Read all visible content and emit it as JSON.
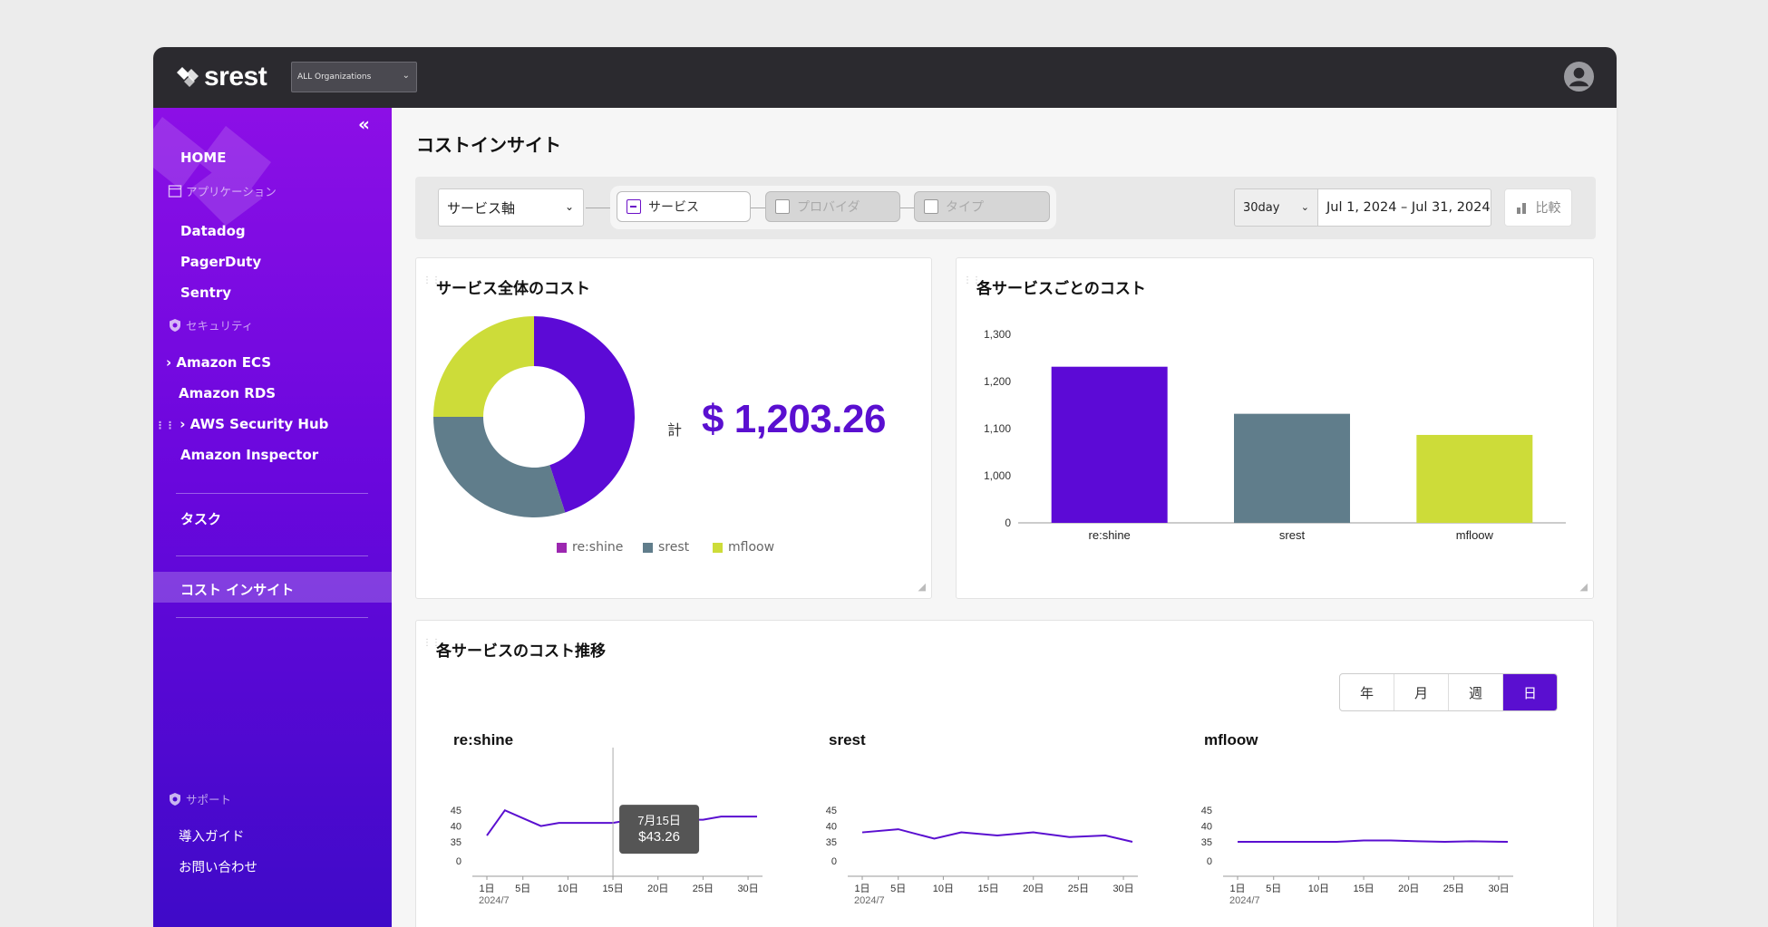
{
  "header": {
    "logo": "srest",
    "org_select": "ALL Organizations"
  },
  "sidebar": {
    "home": "HOME",
    "section_apps": "アプリケーション",
    "apps": [
      "Datadog",
      "PagerDuty",
      "Sentry"
    ],
    "section_security": "セキュリティ",
    "security": [
      "Amazon ECS",
      "Amazon RDS",
      "AWS Security Hub",
      "Amazon Inspector"
    ],
    "task": "タスク",
    "cost_insight": "コスト インサイト",
    "section_support": "サポート",
    "support": [
      "導入ガイド",
      "お問い合わせ"
    ]
  },
  "page": {
    "title": "コストインサイト"
  },
  "filters": {
    "axis": "サービス軸",
    "chips": [
      "サービス",
      "プロバイダ",
      "タイプ"
    ],
    "period": "30day",
    "date_range": "Jul 1, 2024  – Jul 31, 2024",
    "compare": "比較"
  },
  "overall": {
    "title": "サービス全体のコスト",
    "total_label": "計",
    "total_value": "$ 1,203.26"
  },
  "per_service": {
    "title": "各サービスごとのコスト"
  },
  "trend": {
    "title": "各サービスのコスト推移",
    "granularity": [
      "年",
      "月",
      "週",
      "日"
    ],
    "active": "日",
    "tooltip": {
      "date": "7月15日",
      "value": "$43.26"
    }
  },
  "colors": {
    "reshine": "#5c0ad6",
    "srest": "#607d8b",
    "mfloow": "#cddc39",
    "line": "#5a0fd0"
  },
  "chart_data": [
    {
      "type": "pie",
      "title": "",
      "categories": [
        "re:shine",
        "srest",
        "mfloow"
      ],
      "values": [
        45,
        30,
        25
      ]
    },
    {
      "type": "bar",
      "title": "",
      "categories": [
        "re:shine",
        "srest",
        "mfloow"
      ],
      "values": [
        1210,
        1112,
        1068
      ],
      "yticks": [
        "0",
        "1,000",
        "1,100",
        "1,200",
        "1,300"
      ],
      "ylim": [
        900,
        1300
      ]
    },
    {
      "type": "line",
      "title": "re:shine",
      "x": [
        1,
        3,
        5,
        7,
        9,
        11,
        13,
        15,
        17,
        19,
        21,
        23,
        25,
        27,
        29,
        31
      ],
      "values": [
        37,
        45,
        42.5,
        40,
        41,
        41,
        41,
        41,
        42,
        42,
        42,
        42,
        42,
        43,
        43,
        43
      ],
      "xticks": [
        "1日",
        "5日",
        "10日",
        "15日",
        "20日",
        "25日",
        "30日"
      ],
      "xsub": "2024/7",
      "yticks": [
        "0",
        "35",
        "40",
        "45"
      ]
    },
    {
      "type": "line",
      "title": "srest",
      "x": [
        1,
        5,
        9,
        12,
        16,
        20,
        24,
        28,
        31
      ],
      "values": [
        38,
        39,
        36,
        38,
        37,
        38,
        36.5,
        37,
        35
      ],
      "xticks": [
        "1日",
        "5日",
        "10日",
        "15日",
        "20日",
        "25日",
        "30日"
      ],
      "xsub": "2024/7",
      "yticks": [
        "0",
        "35",
        "40",
        "45"
      ]
    },
    {
      "type": "line",
      "title": "mfloow",
      "x": [
        1,
        5,
        9,
        12,
        15,
        18,
        21,
        24,
        27,
        31
      ],
      "values": [
        35,
        35,
        35,
        35,
        32.5,
        32.5,
        34,
        35,
        34,
        35
      ],
      "xticks": [
        "1日",
        "5日",
        "10日",
        "15日",
        "20日",
        "25日",
        "30日"
      ],
      "xsub": "2024/7",
      "yticks": [
        "0",
        "35",
        "40",
        "45"
      ]
    }
  ]
}
